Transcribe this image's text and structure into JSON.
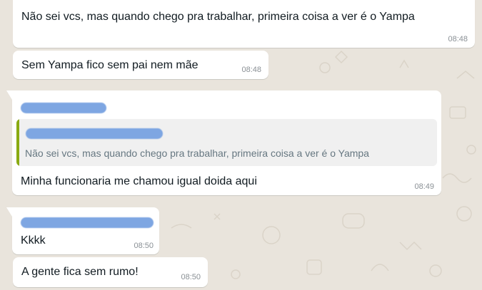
{
  "messages": [
    {
      "text": "Não sei vcs, mas quando chego pra trabalhar,  primeira coisa a ver é o Yampa",
      "time": "08:48"
    },
    {
      "text": "Sem Yampa fico sem pai nem mãe",
      "time": "08:48"
    },
    {
      "text": "Minha funcionaria me chamou igual doida aqui",
      "time": "08:49",
      "quote": {
        "text": "Não sei vcs, mas quando chego pra trabalhar,  primeira coisa a ver é o Yampa"
      }
    },
    {
      "text": "Kkkk",
      "time": "08:50"
    },
    {
      "text": "A gente fica sem rumo!",
      "time": "08:50"
    }
  ],
  "colors": {
    "background": "#e9e4dc",
    "bubble": "#ffffff",
    "sender_redaction": "#7ea6e2",
    "quote_accent": "#8aaa12",
    "quote_background": "#f0f0f0"
  }
}
